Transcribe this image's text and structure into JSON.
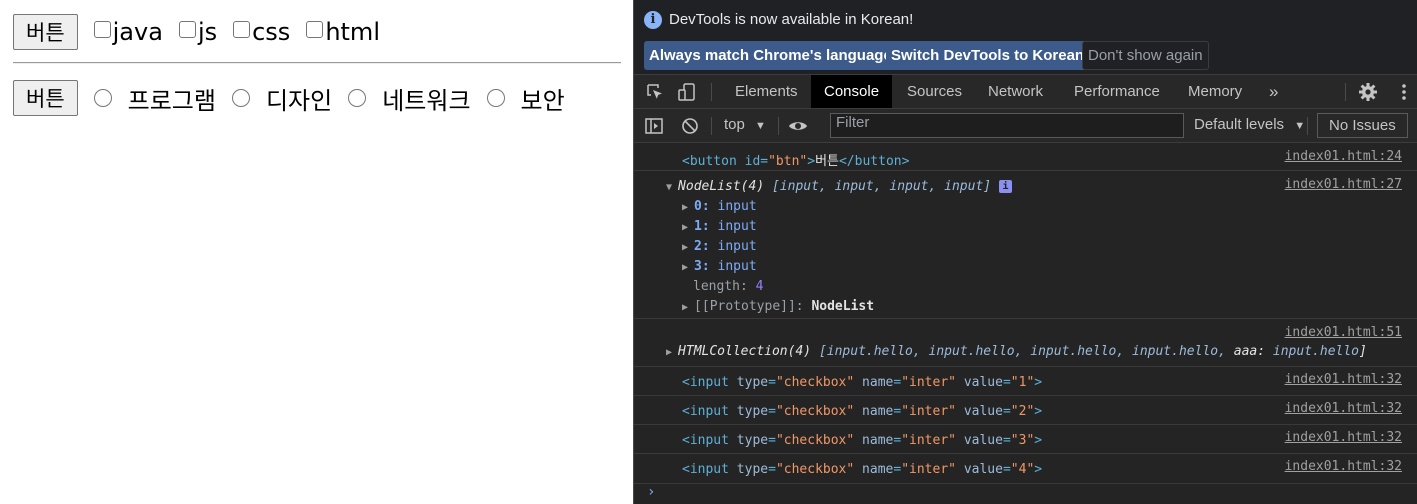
{
  "page": {
    "row1": {
      "button": "버튼",
      "checkboxes": [
        "java",
        "js",
        "css",
        "html"
      ]
    },
    "row2": {
      "button": "버튼",
      "radios": [
        "프로그램",
        "디자인",
        "네트워크",
        "보안"
      ]
    }
  },
  "devtools": {
    "infobar": {
      "message": "DevTools is now available in Korean!",
      "match_button": "Always match Chrome's language",
      "switch_button": "Switch DevTools to Korean",
      "dismiss_button": "Don't show again"
    },
    "tabs": [
      "Elements",
      "Console",
      "Sources",
      "Network",
      "Performance",
      "Memory"
    ],
    "active_tab": "Console",
    "more_tabs": "»",
    "filterbar": {
      "context": "top",
      "filter_placeholder": "Filter",
      "levels": "Default levels",
      "issues": "No Issues"
    },
    "messages": [
      {
        "source": "index01.html:24",
        "parts": [
          "<button id=",
          "\"btn\"",
          ">",
          "버튼",
          "</button>"
        ]
      },
      {
        "source": "index01.html:27",
        "summary_name": "NodeList(4)",
        "summary_items": "[input, input, input, input]",
        "entries": [
          {
            "key": "0",
            "value": "input"
          },
          {
            "key": "1",
            "value": "input"
          },
          {
            "key": "2",
            "value": "input"
          },
          {
            "key": "3",
            "value": "input"
          }
        ],
        "length_label": "length",
        "length_value": "4",
        "prototype_label": "[[Prototype]]",
        "prototype_value": "NodeList"
      },
      {
        "source": "index01.html:51",
        "summary_name": "HTMLCollection(4)",
        "summary_items": "[input.hello, input.hello, input.hello, input.hello, ",
        "summary_key": "aaa",
        "summary_tail": "input.hello",
        "summary_close": "]"
      },
      {
        "source": "index01.html:32",
        "type": "checkbox",
        "name": "inter",
        "value": "1"
      },
      {
        "source": "index01.html:32",
        "type": "checkbox",
        "name": "inter",
        "value": "2"
      },
      {
        "source": "index01.html:32",
        "type": "checkbox",
        "name": "inter",
        "value": "3"
      },
      {
        "source": "index01.html:32",
        "type": "checkbox",
        "name": "inter",
        "value": "4"
      }
    ],
    "prompt": "›"
  },
  "colors": {
    "devtools_bg": "#242424",
    "accent_button": "#3c5a8a",
    "tag": "#5db0d7",
    "attr_value": "#f29766"
  }
}
